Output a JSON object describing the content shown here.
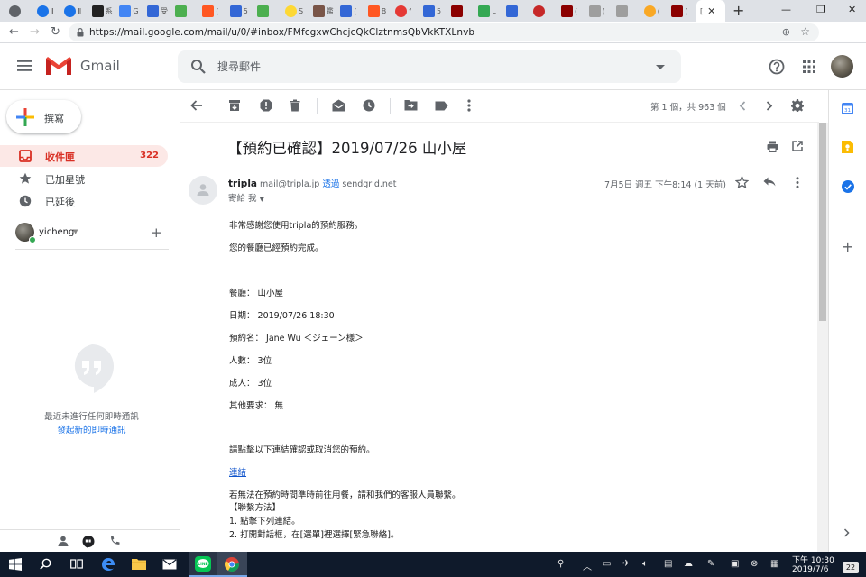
{
  "browser": {
    "tabs": [
      {
        "label": "",
        "color": "#5f6368",
        "round": true
      },
      {
        "label": "Ⅱ",
        "color": "#1a73e8",
        "round": true
      },
      {
        "label": "Ⅱ",
        "color": "#1a73e8",
        "round": true
      },
      {
        "label": "系",
        "color": "#222222",
        "round": false
      },
      {
        "label": "G",
        "color": "#4285f4",
        "round": false
      },
      {
        "label": "受",
        "color": "#3367d6",
        "round": false
      },
      {
        "label": "",
        "color": "#4caf50",
        "round": false
      },
      {
        "label": "(",
        "color": "#ff5722",
        "round": false
      },
      {
        "label": "5",
        "color": "#3367d6",
        "round": false
      },
      {
        "label": "",
        "color": "#4caf50",
        "round": false
      },
      {
        "label": "S",
        "color": "#fdd835",
        "round": true
      },
      {
        "label": "鑑",
        "color": "#795548",
        "round": false
      },
      {
        "label": "(",
        "color": "#3367d6",
        "round": false
      },
      {
        "label": "B",
        "color": "#ff5722",
        "round": false
      },
      {
        "label": "f",
        "color": "#e53935",
        "round": true
      },
      {
        "label": "5",
        "color": "#3367d6",
        "round": false
      },
      {
        "label": "",
        "color": "#8b0000",
        "round": false
      },
      {
        "label": "L",
        "color": "#34a853",
        "round": false
      },
      {
        "label": "",
        "color": "#3367d6",
        "round": false
      },
      {
        "label": "",
        "color": "#c62828",
        "round": true
      },
      {
        "label": "(",
        "color": "#8b0000",
        "round": false
      },
      {
        "label": "(",
        "color": "#9e9e9e",
        "round": false
      },
      {
        "label": "",
        "color": "#9e9e9e",
        "round": false
      },
      {
        "label": "(",
        "color": "#f9a825",
        "round": true
      },
      {
        "label": "(",
        "color": "#8b0000",
        "round": false
      }
    ],
    "active_tab_label": "[",
    "url": "https://mail.google.com/mail/u/0/#inbox/FMfcgxwChcjcQkClztnmsQbVkKTXLnvb"
  },
  "gmail": {
    "brand": "Gmail",
    "search_placeholder": "搜尋郵件",
    "compose_label": "撰寫",
    "nav": {
      "inbox": {
        "label": "收件匣",
        "count": "322"
      },
      "starred": {
        "label": "已加星號"
      },
      "snoozed": {
        "label": "已延後"
      }
    },
    "hangouts": {
      "user": "yicheng",
      "no_chats": "最近未進行任何即時通訊",
      "start_chat": "發起新的即時通訊"
    },
    "pager": "第 1 個，共 963 個"
  },
  "message": {
    "subject": "【預約已確認】2019/07/26 山小屋",
    "sender_name": "tripla",
    "sender_email": "mail@tripla.jp",
    "via_label": "透過",
    "via_domain": "sendgrid.net",
    "to_line": "寄給 我",
    "date": "7月5日 週五 下午8:14 (1 天前)",
    "body": {
      "greeting": "非常感謝您使用tripla的預約服務。",
      "confirmed": "您的餐廳已經預約完成。",
      "restaurant": "餐廳： 山小屋",
      "date": "日期： 2019/07/26 18:30",
      "name": "預約名： Jane Wu ＜ジェーン様＞",
      "people": "人數： 3位",
      "adults": "成人： 3位",
      "other": "其他要求： 無",
      "instruction": "請點擊以下連結確認或取消您的預約。",
      "link": "連結",
      "contact": "若無法在預約時間準時前往用餐，請和我們的客服人員聯繫。",
      "method_title": "【聯繫方法】",
      "method_1": "1. 點擊下列連結。",
      "method_2": "2. 打開對話框，在[選單]裡選擇[緊急聯絡]。"
    }
  },
  "taskbar": {
    "time": "下午 10:30",
    "date": "2019/7/6",
    "notifications": "22"
  },
  "colors": {
    "accent_red": "#d93025",
    "inbox_bg": "#fce8e6",
    "link_blue": "#1a73e8",
    "taskbar_bg": "#0f1a2b"
  }
}
